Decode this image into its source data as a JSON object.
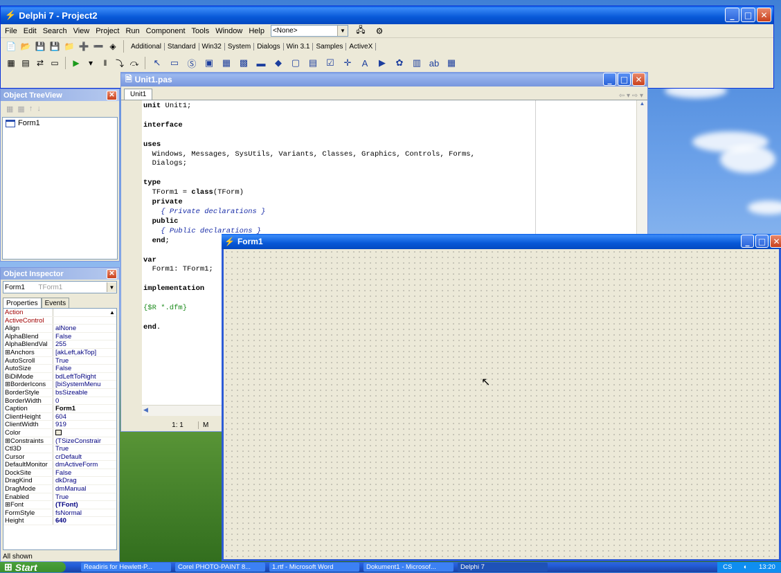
{
  "main_window": {
    "title": "Delphi 7 - Project2",
    "menu": [
      "File",
      "Edit",
      "Search",
      "View",
      "Project",
      "Run",
      "Component",
      "Tools",
      "Window",
      "Help"
    ],
    "desktop_combo": "<None>",
    "palette_tabs": [
      "Additional",
      "Standard",
      "Win32",
      "System",
      "Dialogs",
      "Win 3.1",
      "Samples",
      "ActiveX"
    ]
  },
  "tree_view": {
    "title": "Object TreeView",
    "items": [
      "Form1"
    ]
  },
  "inspector": {
    "title": "Object Inspector",
    "object_name": "Form1",
    "object_type": "TForm1",
    "tabs": [
      "Properties",
      "Events"
    ],
    "status": "All shown",
    "rows": [
      {
        "name": "Action",
        "value": ""
      },
      {
        "name": "ActiveControl",
        "value": ""
      },
      {
        "name": "Align",
        "value": "alNone"
      },
      {
        "name": "AlphaBlend",
        "value": "False"
      },
      {
        "name": "AlphaBlendVal",
        "value": "255"
      },
      {
        "name": "⊞Anchors",
        "value": "[akLeft,akTop]"
      },
      {
        "name": "AutoScroll",
        "value": "True"
      },
      {
        "name": "AutoSize",
        "value": "False"
      },
      {
        "name": "BiDiMode",
        "value": "bdLeftToRight"
      },
      {
        "name": "⊞BorderIcons",
        "value": "[biSystemMenu"
      },
      {
        "name": "BorderStyle",
        "value": "bsSizeable"
      },
      {
        "name": "BorderWidth",
        "value": "0"
      },
      {
        "name": "Caption",
        "value": "Form1"
      },
      {
        "name": "ClientHeight",
        "value": "604"
      },
      {
        "name": "ClientWidth",
        "value": "919"
      },
      {
        "name": "Color",
        "value": "clBtnFace"
      },
      {
        "name": "⊞Constraints",
        "value": "(TSizeConstrair"
      },
      {
        "name": "Ctl3D",
        "value": "True"
      },
      {
        "name": "Cursor",
        "value": "crDefault"
      },
      {
        "name": "DefaultMonitor",
        "value": "dmActiveForm"
      },
      {
        "name": "DockSite",
        "value": "False"
      },
      {
        "name": "DragKind",
        "value": "dkDrag"
      },
      {
        "name": "DragMode",
        "value": "dmManual"
      },
      {
        "name": "Enabled",
        "value": "True"
      },
      {
        "name": "⊞Font",
        "value": "(TFont)"
      },
      {
        "name": "FormStyle",
        "value": "fsNormal"
      },
      {
        "name": "Height",
        "value": "640"
      }
    ]
  },
  "unit_window": {
    "title": "Unit1.pas",
    "tab": "Unit1",
    "cursor_pos": "1: 1",
    "mode": "M"
  },
  "form1": {
    "title": "Form1"
  },
  "taskbar": {
    "start": "Start",
    "tasks": [
      "Readiris for Hewlett-P...",
      "Corel PHOTO-PAINT 8...",
      "1.rtf - Microsoft Word",
      "Dokument1 - Microsof...",
      "Delphi 7"
    ],
    "lang": "CS",
    "clock": "13:20"
  },
  "colors": {
    "xp_blue": "#0a5fe8",
    "face": "#ece9d8",
    "keyword": "#000000",
    "comment": "#1a2ea8"
  }
}
